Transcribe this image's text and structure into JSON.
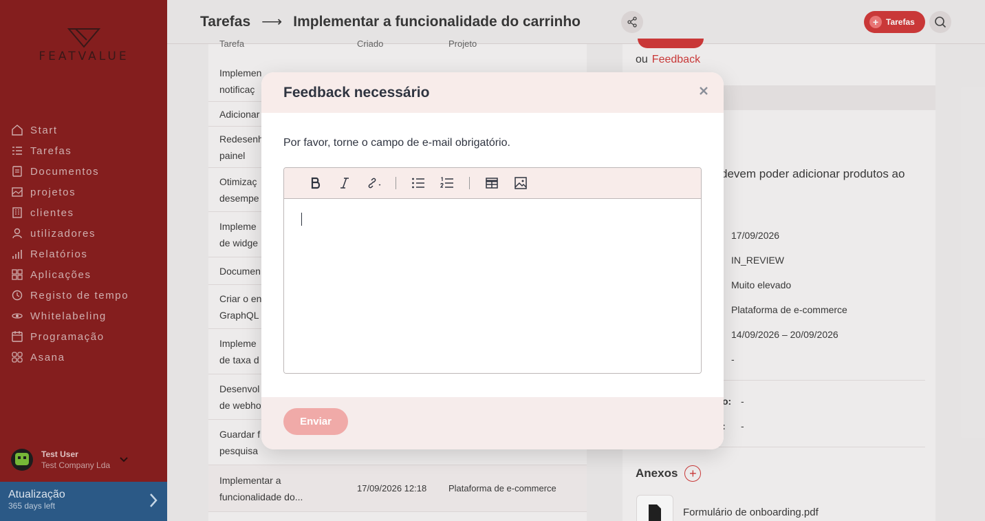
{
  "brand": {
    "name": "FEATVALUE"
  },
  "sidebar": {
    "items": [
      {
        "label": "Start",
        "icon": "home-icon"
      },
      {
        "label": "Tarefas",
        "icon": "tasks-icon"
      },
      {
        "label": "Documentos",
        "icon": "documents-icon"
      },
      {
        "label": "projetos",
        "icon": "projects-icon"
      },
      {
        "label": "clientes",
        "icon": "clients-icon"
      },
      {
        "label": "utilizadores",
        "icon": "users-icon"
      },
      {
        "label": "Relatórios",
        "icon": "reports-icon"
      },
      {
        "label": "Aplicações",
        "icon": "apps-icon"
      },
      {
        "label": "Registo de tempo",
        "icon": "time-icon"
      },
      {
        "label": "Whitelabeling",
        "icon": "whitelabel-icon"
      },
      {
        "label": "Programação",
        "icon": "schedule-icon"
      },
      {
        "label": "Asana",
        "icon": "asana-icon"
      }
    ],
    "user": {
      "name": "Test User",
      "company": "Test Company Lda"
    },
    "upgrade": {
      "title": "Atualização",
      "subtitle": "365 days left"
    }
  },
  "header": {
    "section": "Tarefas",
    "title": "Implementar a funcionalidade do carrinho",
    "tarefas_button": "Tarefas"
  },
  "list": {
    "headers": [
      "Tarefa",
      "Criado",
      "Projeto"
    ],
    "rows": [
      {
        "line1": "Implemen",
        "line2": "notificaç"
      },
      {
        "line1": "Adicionar",
        "line2": ""
      },
      {
        "line1": "Redesenh",
        "line2": "painel"
      },
      {
        "line1": "Otimizaç",
        "line2": "desempe"
      },
      {
        "line1": "Impleme",
        "line2": "de widge"
      },
      {
        "line1": "Documen",
        "line2": ""
      },
      {
        "line1": "Criar o en",
        "line2": "GraphQL"
      },
      {
        "line1": "Impleme",
        "line2": "de taxa d"
      },
      {
        "line1": "Desenvol",
        "line2": "de webho"
      },
      {
        "line1": "Guardar f",
        "line2": "pesquisa"
      },
      {
        "line1": "Implementar a",
        "line2": "funcionalidade do...",
        "date": "17/09/2026 12:18",
        "project": "Plataforma de e-commerce"
      }
    ]
  },
  "detail": {
    "ou": "ou",
    "feedback_link": "Feedback",
    "description": "devem poder adicionar produtos ao",
    "fields": [
      "17/09/2026",
      "IN_REVIEW",
      "Muito elevado",
      "Plataforma de e-commerce",
      "14/09/2026 – 20/09/2026",
      "-"
    ],
    "extra_labels": [
      "o:",
      ":"
    ],
    "extra_values": [
      "-",
      "-"
    ],
    "attachments_title": "Anexos",
    "attachment": "Formulário de onboarding.pdf"
  },
  "modal": {
    "title": "Feedback necessário",
    "message": "Por favor, torne o campo de e-mail obrigatório.",
    "send_label": "Enviar",
    "toolbar": [
      "bold-icon",
      "italic-icon",
      "link-icon",
      "bullet-list-icon",
      "numbered-list-icon",
      "table-icon",
      "image-icon"
    ]
  },
  "colors": {
    "sidebar": "#8a2020",
    "accent": "#d23b3b",
    "upgrade": "#2d5d8c",
    "send_disabled": "#f0aaa8"
  }
}
